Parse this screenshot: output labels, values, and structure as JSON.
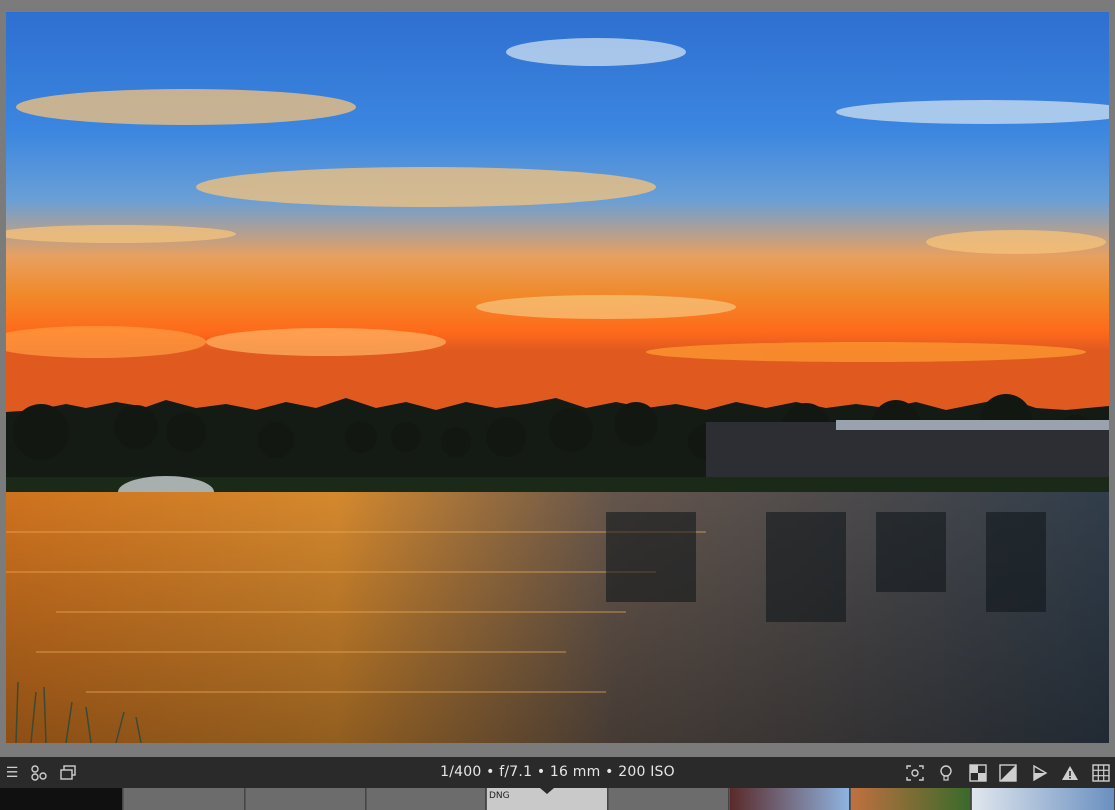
{
  "toolbar": {
    "exif": "1/400 • f/7.1 • 16 mm • 200 ISO",
    "left_icons": [
      "menu-icon",
      "share-nodes-icon",
      "duplicate-screens-icon"
    ],
    "right_icons": [
      "focus-frame-icon",
      "lightbulb-icon",
      "checker-icon",
      "contrast-icon",
      "softproof-icon",
      "warning-icon",
      "grid-icon"
    ]
  },
  "filmstrip": {
    "selected_label": "DNG"
  },
  "colors": {
    "background": "#7b7b7b",
    "toolbar": "#2a2a2a",
    "filmstrip": "#565656"
  }
}
